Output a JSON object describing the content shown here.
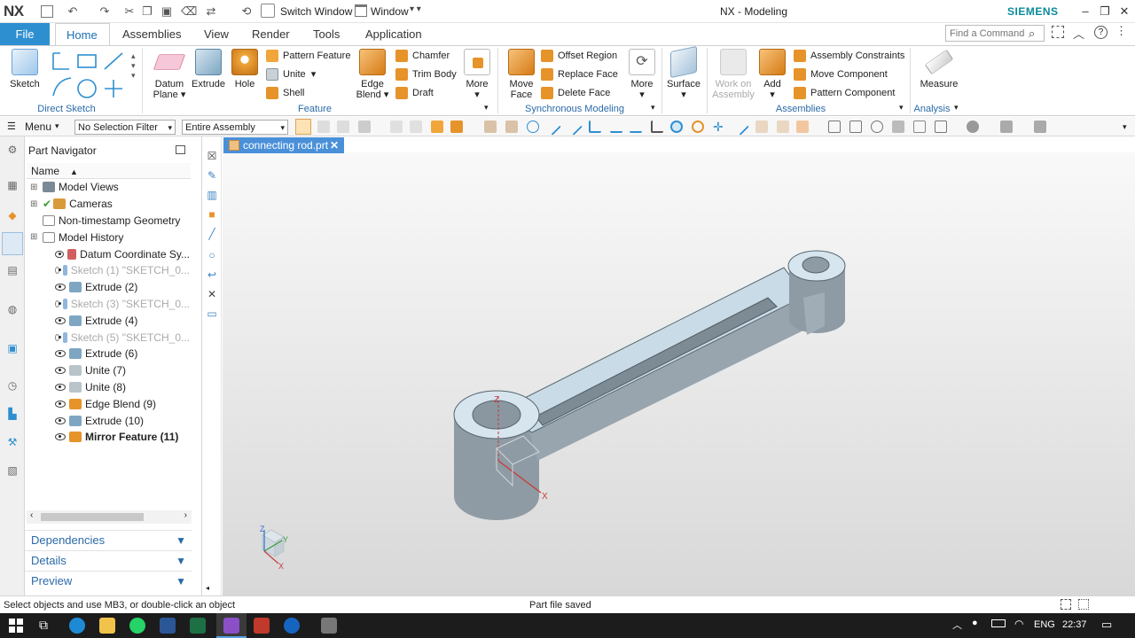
{
  "app": {
    "logo": "NX",
    "window_title": "NX - Modeling",
    "brand": "SIEMENS"
  },
  "quick_access": {
    "switch_window": "Switch Window",
    "window_menu": "Window"
  },
  "tabs": [
    "File",
    "Home",
    "Assemblies",
    "View",
    "Render",
    "Tools",
    "Application"
  ],
  "find_command": {
    "placeholder": "Find a Command"
  },
  "ribbon": {
    "direct_sketch": {
      "sketch": "Sketch",
      "group": "Direct Sketch"
    },
    "feature": {
      "datum_plane": "Datum Plane",
      "extrude": "Extrude",
      "hole": "Hole",
      "pattern_feature": "Pattern Feature",
      "unite": "Unite",
      "shell": "Shell",
      "edge_blend": "Edge Blend",
      "chamfer": "Chamfer",
      "trim_body": "Trim Body",
      "draft": "Draft",
      "more": "More",
      "group": "Feature"
    },
    "sync": {
      "move_face": "Move Face",
      "offset_region": "Offset Region",
      "replace_face": "Replace Face",
      "delete_face": "Delete Face",
      "more": "More",
      "group": "Synchronous Modeling"
    },
    "surface": {
      "label": "Surface"
    },
    "assemblies": {
      "work_on_assembly": "Work on Assembly",
      "add": "Add",
      "assembly_constraints": "Assembly Constraints",
      "move_component": "Move Component",
      "pattern_component": "Pattern Component",
      "group": "Assemblies"
    },
    "analysis": {
      "measure": "Measure",
      "group": "Analysis"
    }
  },
  "commandbar": {
    "menu": "Menu",
    "selection_filter": "No Selection Filter",
    "scope": "Entire Assembly"
  },
  "navigator": {
    "title": "Part Navigator",
    "column_name": "Name",
    "items": [
      {
        "label": "Model Views",
        "level": 0,
        "state": "normal",
        "icon": "views-icon"
      },
      {
        "label": "Cameras",
        "level": 0,
        "state": "normal",
        "icon": "camera-icon"
      },
      {
        "label": "Non-timestamp Geometry",
        "level": 0,
        "state": "normal",
        "icon": "folder-icon"
      },
      {
        "label": "Model History",
        "level": 0,
        "state": "normal",
        "icon": "folder-icon"
      },
      {
        "label": "Datum Coordinate Sy...",
        "level": 1,
        "state": "normal",
        "icon": "datum-csys-icon"
      },
      {
        "label": "Sketch (1) \"SKETCH_0...",
        "level": 1,
        "state": "dim",
        "icon": "sketch-icon"
      },
      {
        "label": "Extrude (2)",
        "level": 1,
        "state": "normal",
        "icon": "extrude-icon"
      },
      {
        "label": "Sketch (3) \"SKETCH_0...",
        "level": 1,
        "state": "dim",
        "icon": "sketch-icon"
      },
      {
        "label": "Extrude (4)",
        "level": 1,
        "state": "normal",
        "icon": "extrude-icon"
      },
      {
        "label": "Sketch (5) \"SKETCH_0...",
        "level": 1,
        "state": "dim",
        "icon": "sketch-icon"
      },
      {
        "label": "Extrude (6)",
        "level": 1,
        "state": "normal",
        "icon": "extrude-icon"
      },
      {
        "label": "Unite (7)",
        "level": 1,
        "state": "normal",
        "icon": "unite-icon"
      },
      {
        "label": "Unite (8)",
        "level": 1,
        "state": "normal",
        "icon": "unite-icon"
      },
      {
        "label": "Edge Blend (9)",
        "level": 1,
        "state": "normal",
        "icon": "edge-blend-icon"
      },
      {
        "label": "Extrude (10)",
        "level": 1,
        "state": "normal",
        "icon": "extrude-icon"
      },
      {
        "label": "Mirror Feature (11)",
        "level": 1,
        "state": "bold",
        "icon": "mirror-icon"
      }
    ],
    "panels": [
      "Dependencies",
      "Details",
      "Preview"
    ]
  },
  "document": {
    "tab": "connecting rod.prt"
  },
  "axes": {
    "x": "X",
    "y": "Y",
    "z": "Z"
  },
  "status": {
    "prompt": "Select objects and use MB3, or double-click an object",
    "message": "Part file saved"
  },
  "taskbar": {
    "language": "ENG",
    "time": "22:37"
  },
  "colors": {
    "accent": "#2e8fd0",
    "part": "#a9b8c2",
    "part_top": "#d9e6ee",
    "label": "#2a6aa8"
  }
}
